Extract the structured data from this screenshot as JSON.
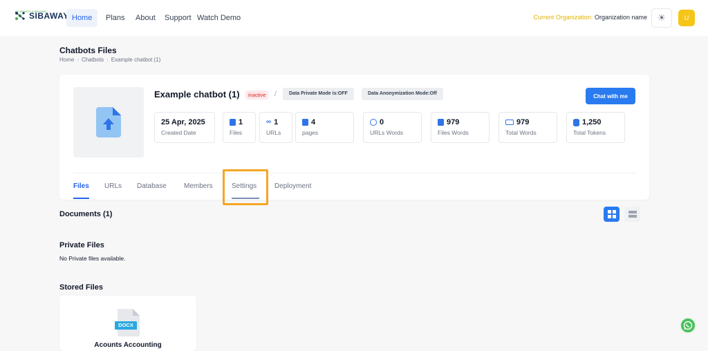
{
  "brand": {
    "name": "SIBAWAY",
    "tagline": "BE INFINITY & BEYOND"
  },
  "nav": {
    "home": "Home",
    "plans": "Plans",
    "about": "About",
    "support": "Support",
    "watch_demo": "Watch Demo"
  },
  "org": {
    "label": "Current Organization:",
    "value": "Organization name"
  },
  "user": {
    "initial": "U"
  },
  "page": {
    "title": "Chatbots Files",
    "breadcrumb": [
      "Home",
      "Chatbots",
      "Example chatbot (1)"
    ]
  },
  "chatbot": {
    "name": "Example chatbot (1)",
    "status": "inactive",
    "private_mode": "Data Private Mode is:OFF",
    "anonymization_mode": "Data Anonymization Mode:Off",
    "chat_button": "Chat with me"
  },
  "stats": [
    {
      "value": "25 Apr, 2025",
      "label": "Created Date",
      "icon": "none"
    },
    {
      "value": "1",
      "label": "Files",
      "icon": "file-icon"
    },
    {
      "value": "1",
      "label": "URLs",
      "icon": "link-icon"
    },
    {
      "value": "4",
      "label": "pages",
      "icon": "file-icon"
    },
    {
      "value": "0",
      "label": "URLs Words",
      "icon": "globe-icon"
    },
    {
      "value": "979",
      "label": "Files Words",
      "icon": "word-file-icon"
    },
    {
      "value": "979",
      "label": "Total Words",
      "icon": "keyboard-icon"
    },
    {
      "value": "1,250",
      "label": "Total Tokens",
      "icon": "database-icon"
    }
  ],
  "tabs": [
    "Files",
    "URLs",
    "Database",
    "Members",
    "Settings",
    "Deployment"
  ],
  "active_tab": "Files",
  "documents": {
    "title": "Documents (1)"
  },
  "private_files": {
    "title": "Private Files",
    "empty": "No Private files available."
  },
  "stored_files": {
    "title": "Stored Files",
    "file_type": "DOCX",
    "file_name": "Acounts Accounting"
  },
  "colors": {
    "primary": "#2a7bf0",
    "highlight": "#f5a623",
    "org_label": "#e0b400",
    "whatsapp": "#49c15a"
  }
}
